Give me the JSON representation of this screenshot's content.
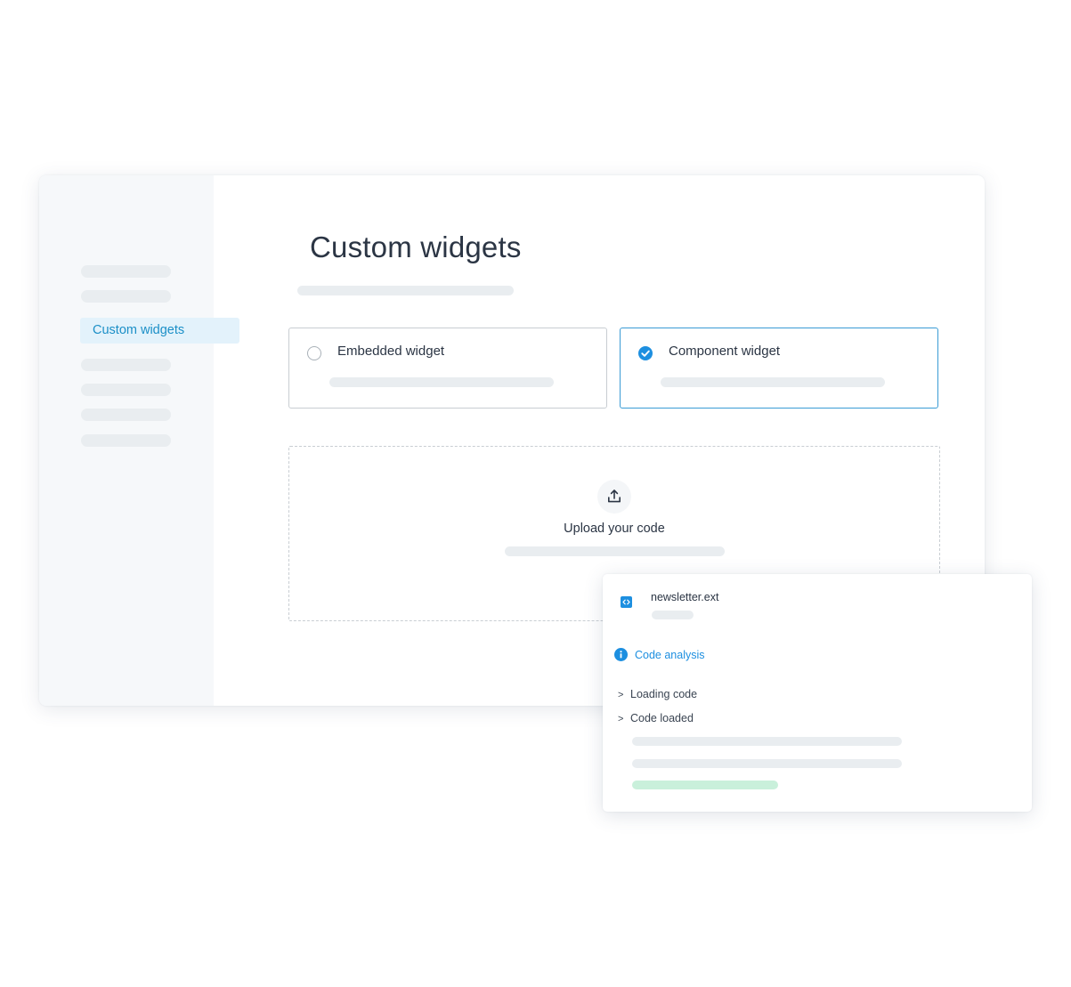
{
  "sidebar": {
    "active_item": "Custom widgets"
  },
  "main": {
    "title": "Custom widgets",
    "options": [
      {
        "label": "Embedded widget",
        "selected": false
      },
      {
        "label": "Component widget",
        "selected": true
      }
    ],
    "upload": {
      "label": "Upload your code",
      "icon": "upload-icon"
    }
  },
  "panel": {
    "file_name": "newsletter.ext",
    "file_icon": "code-file-icon",
    "analysis": {
      "icon": "info-icon",
      "label": "Code analysis"
    },
    "log": [
      {
        "label": "Loading code"
      },
      {
        "label": "Code loaded"
      }
    ]
  },
  "colors": {
    "accent": "#1d8fe0",
    "active_nav_bg": "#e3f2fb",
    "selected_border": "#3a9bd5",
    "success_bar": "#c9f0db",
    "placeholder": "#e9edf0"
  }
}
